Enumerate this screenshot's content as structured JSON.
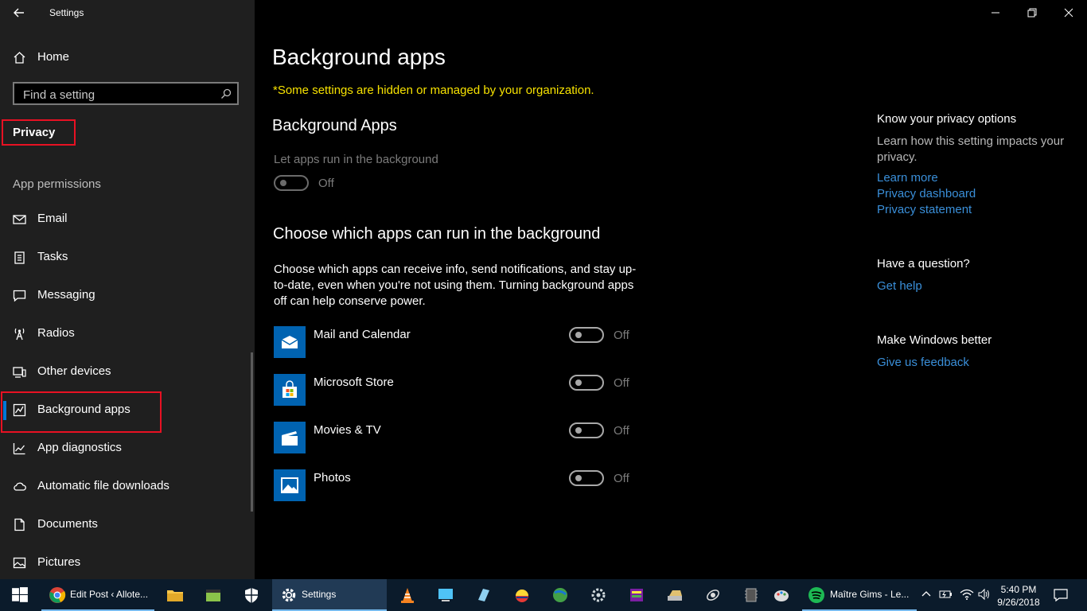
{
  "window": {
    "title": "Settings"
  },
  "sidebar": {
    "home_label": "Home",
    "search_placeholder": "Find a setting",
    "privacy_label": "Privacy",
    "section_label": "App permissions",
    "items": [
      {
        "label": "Email",
        "icon": "mail-icon"
      },
      {
        "label": "Tasks",
        "icon": "tasks-icon"
      },
      {
        "label": "Messaging",
        "icon": "message-icon"
      },
      {
        "label": "Radios",
        "icon": "radio-icon"
      },
      {
        "label": "Other devices",
        "icon": "devices-icon"
      },
      {
        "label": "Background apps",
        "icon": "background-apps-icon",
        "selected": true
      },
      {
        "label": "App diagnostics",
        "icon": "diagnostics-icon"
      },
      {
        "label": "Automatic file downloads",
        "icon": "cloud-icon"
      },
      {
        "label": "Documents",
        "icon": "document-icon"
      },
      {
        "label": "Pictures",
        "icon": "picture-icon"
      }
    ]
  },
  "main": {
    "title": "Background apps",
    "warning": "*Some settings are hidden or managed by your organization.",
    "section1_title": "Background Apps",
    "toggle_label": "Let apps run in the background",
    "toggle_state": "Off",
    "section2_title": "Choose which apps can run in the background",
    "description": "Choose which apps can receive info, send notifications, and stay up-to-date, even when you're not using them. Turning background apps off can help conserve power.",
    "apps": [
      {
        "name": "Mail and Calendar",
        "state": "Off"
      },
      {
        "name": "Microsoft Store",
        "state": "Off"
      },
      {
        "name": "Movies & TV",
        "state": "Off"
      },
      {
        "name": "Photos",
        "state": "Off"
      }
    ]
  },
  "right_panel": {
    "privacy_title": "Know your privacy options",
    "privacy_desc": "Learn how this setting impacts your privacy.",
    "learn_more": "Learn more",
    "privacy_dashboard": "Privacy dashboard",
    "privacy_statement": "Privacy statement",
    "question_title": "Have a question?",
    "get_help": "Get help",
    "better_title": "Make Windows better",
    "feedback": "Give us feedback"
  },
  "taskbar": {
    "chrome_label": "Edit Post ‹ Allote...",
    "settings_label": "Settings",
    "spotify_label": "Maître Gims - Le...",
    "time": "5:40 PM",
    "date": "9/26/2018"
  },
  "colors": {
    "accent": "#0078d7",
    "warning": "#f7e200",
    "link": "#3a8fd9",
    "highlight_border": "#e81123"
  }
}
